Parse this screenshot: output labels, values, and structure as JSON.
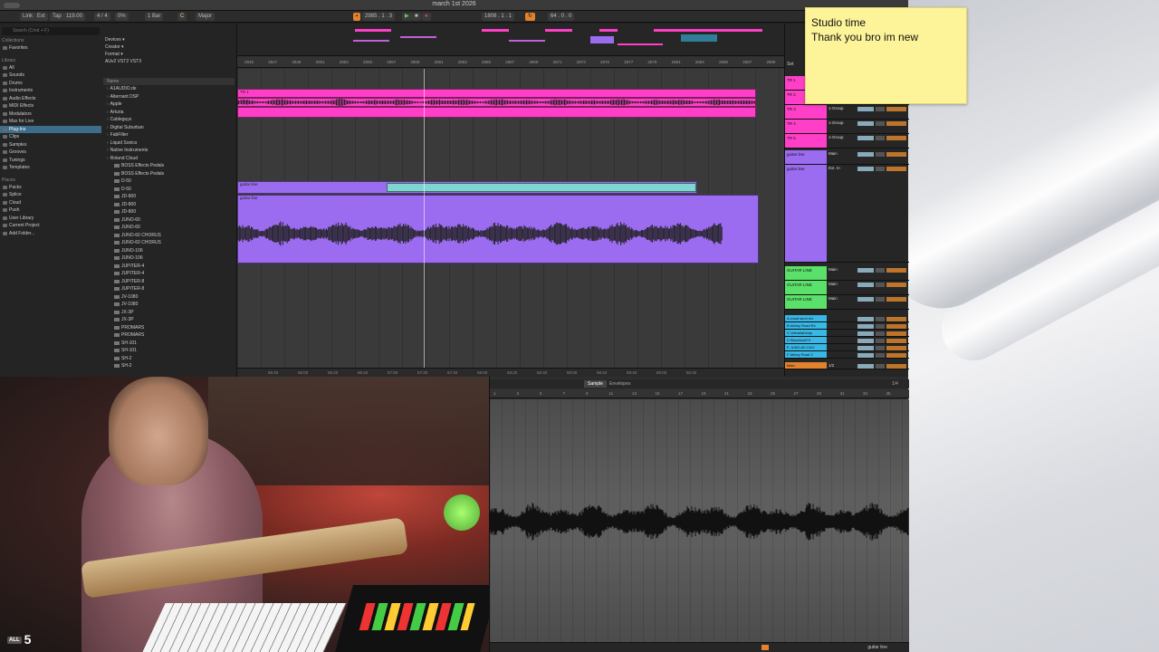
{
  "window": {
    "title": "march 1st 2026"
  },
  "transport": {
    "link": "Link",
    "ext": "Ext",
    "tap": "Tap",
    "tempo": "119.00",
    "signature": "4 / 4",
    "loop_pct": "0%",
    "bar": "1 Bar",
    "key": "C",
    "scale": "Major",
    "position": "2985 . 1 . 3",
    "loop_start": "1808 . 1 . 1",
    "loop_len": "64 . 0 . 0"
  },
  "browser": {
    "search_placeholder": "Search (Cmd + F)",
    "collections_header": "Collections",
    "favorites": "Favorites",
    "library_header": "Library",
    "library": [
      "All",
      "Sounds",
      "Drums",
      "Instruments",
      "Audio Effects",
      "MIDI Effects",
      "Modulators",
      "Max for Live",
      "Plug-Ins",
      "Clips",
      "Samples",
      "Grooves",
      "Tunings",
      "Templates"
    ],
    "selected_index": 8,
    "places_header": "Places",
    "places": [
      "Packs",
      "Splice",
      "Cloud",
      "Push",
      "User Library",
      "Current Project",
      "Add Folder..."
    ],
    "filters": [
      "Devices ▾",
      "Creator ▾",
      "Format ▾"
    ],
    "format_tags": "AUv2   VST2   VST3",
    "names_header": "Name",
    "vendors": [
      "A1AUDIO.de",
      "Alternant DSP",
      "Apple",
      "Arturia",
      "Cableguys",
      "Digital Suburban",
      "FabFilter",
      "Liquid Sonics",
      "Native Instruments",
      "Roland Cloud"
    ],
    "roland_items": [
      "BOSS Effects Pedals",
      "BOSS Effects Pedals",
      "D-50",
      "D-50",
      "JD-800",
      "JD-800",
      "JD-800",
      "JUNO-60",
      "JUNO-60",
      "JUNO-60 CHORUS",
      "JUNO-60 CHORUS",
      "JUNO-106",
      "JUNO-106",
      "JUPITER-4",
      "JUPITER-4",
      "JUPITER-8",
      "JUPITER-8",
      "JV-1080",
      "JV-1080",
      "JX-3P",
      "JX-3P",
      "PROMARS",
      "PROMARS",
      "SH-101",
      "SH-101",
      "SH-2",
      "SH-2"
    ]
  },
  "arrangement": {
    "ruler_ticks": [
      "2845",
      "2847",
      "2849",
      "2851",
      "2853",
      "2855",
      "2857",
      "2859",
      "2861",
      "2863",
      "2865",
      "2867",
      "2869",
      "2871",
      "2873",
      "2875",
      "2877",
      "2879",
      "2881",
      "2883",
      "2885",
      "2887",
      "2889"
    ],
    "time_ticks": [
      "55:40",
      "56:00",
      "56:20",
      "56:40",
      "57:00",
      "57:20",
      "57:40",
      "58:00",
      "58:20",
      "58:40",
      "59:00",
      "59:20",
      "59:40",
      "60:00",
      "60:20"
    ],
    "clip_labels": {
      "guitar1": "guitar line",
      "guitar2": "guitar line",
      "tr1": "TR 1",
      "tr2": "TR 2"
    },
    "set_label": "Set"
  },
  "mixer": {
    "tracks": [
      {
        "name": "TR 1",
        "route": "1-Group",
        "color": "#ff3fc7"
      },
      {
        "name": "TR 2",
        "route": "1-Group",
        "color": "#ff3fc7"
      },
      {
        "name": "TR 3",
        "route": "1-Group",
        "color": "#ff3fc7"
      },
      {
        "name": "TR 4",
        "route": "1-Group",
        "color": "#ff3fc7"
      },
      {
        "name": "TR 5",
        "route": "1-Group",
        "color": "#ff3fc7"
      },
      {
        "name": "guitar line",
        "route": "Main",
        "color": "#9b6cf0"
      },
      {
        "name": "guitar line",
        "route": "Ext. In",
        "color": "#9b6cf0"
      },
      {
        "name": "GUITAR LINE",
        "route": "Main",
        "color": "#5be06a"
      },
      {
        "name": "GUITAR LINE",
        "route": "Main",
        "color": "#5be06a"
      },
      {
        "name": "GUITAR LINE",
        "route": "Main",
        "color": "#5be06a"
      },
      {
        "name": "A vocal send rev",
        "route": "",
        "color": "#37b8e6"
      },
      {
        "name": "B Abbey Road Re",
        "route": "",
        "color": "#37b8e6"
      },
      {
        "name": "C ValhallaDelay",
        "route": "",
        "color": "#37b8e6"
      },
      {
        "name": "D BlackholeFX",
        "route": "",
        "color": "#37b8e6"
      },
      {
        "name": "E JUNO-60 CHO",
        "route": "",
        "color": "#37b8e6"
      },
      {
        "name": "F Abbey Road 2",
        "route": "",
        "color": "#37b8e6"
      },
      {
        "name": "Main",
        "route": "1/2",
        "color": "#e3822d"
      }
    ]
  },
  "sticky": {
    "line1": "Studio time",
    "line2": "Thank you bro im new"
  },
  "detail": {
    "tab_sample": "Sample",
    "tab_envelopes": "Envelopes",
    "zoom": "1/4",
    "ruler_ticks": [
      "1",
      "3",
      "5",
      "7",
      "9",
      "11",
      "13",
      "15",
      "17",
      "19",
      "21",
      "23",
      "25",
      "27",
      "29",
      "31",
      "33",
      "35"
    ],
    "clip_name": "guitar line"
  },
  "overlay": {
    "all_label": "ALL",
    "count": "5"
  },
  "colors": {
    "pink": "#ff3fc7",
    "purple": "#9b6cf0",
    "green": "#5be06a",
    "cyan": "#37b8e6",
    "orange": "#e3822d"
  }
}
